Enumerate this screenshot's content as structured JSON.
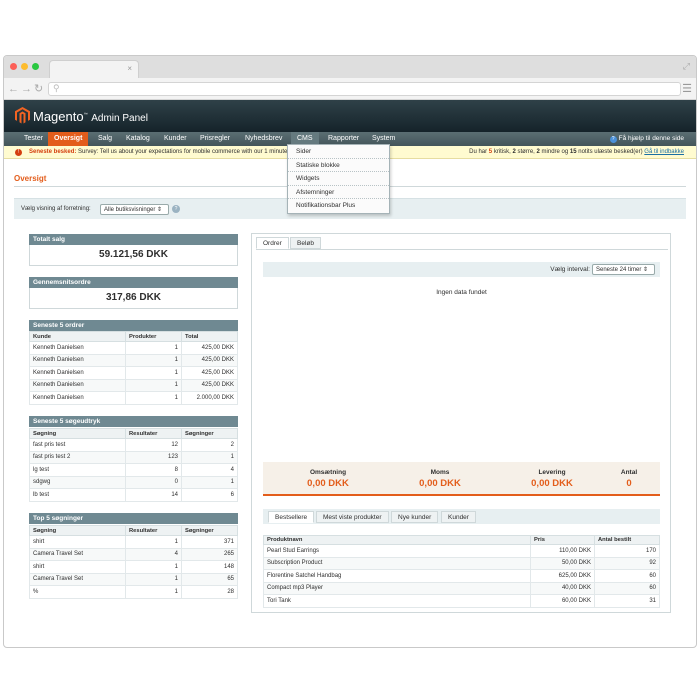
{
  "header": {
    "logo": "Magento",
    "logo_sub": "Admin Panel"
  },
  "nav": {
    "items": [
      "Tester",
      "Oversigt",
      "Salg",
      "Katalog",
      "Kunder",
      "Prisregler",
      "Nyhedsbrev",
      "CMS",
      "Rapporter",
      "System"
    ],
    "help": "Få hjælp til denne side"
  },
  "cms_menu": [
    "Sider",
    "Statiske blokke",
    "Widgets",
    "Afstemninger",
    "Notifikationsbar Plus"
  ],
  "notice": {
    "latest_label": "Seneste besked:",
    "message": "Survey: Tell us about your expectations for mobile commerce with our 1 minute",
    "prefix": "Du har",
    "critical_count": "5",
    "critical_label": "kritisk,",
    "major_count": "2",
    "major_label": "større,",
    "minor_count": "2",
    "minor_label": "mindre og",
    "notice_count": "15",
    "notice_label": "notits ulæste besked(er)",
    "link": "Gå til indbakke"
  },
  "page_title": "Oversigt",
  "store_switcher": {
    "label": "Vælg visning af forretning:",
    "value": "Alle butiksvisninger",
    "help": "?"
  },
  "total_sales": {
    "title": "Totalt salg",
    "value": "59.121,56 DKK"
  },
  "avg_order": {
    "title": "Gennemsnitsordre",
    "value": "317,86 DKK"
  },
  "last_orders": {
    "title": "Seneste 5 ordrer",
    "headers": [
      "Kunde",
      "Produkter",
      "Total"
    ],
    "rows": [
      [
        "Kenneth Danielsen",
        "1",
        "425,00 DKK"
      ],
      [
        "Kenneth Danielsen",
        "1",
        "425,00 DKK"
      ],
      [
        "Kenneth Danielsen",
        "1",
        "425,00 DKK"
      ],
      [
        "Kenneth Danielsen",
        "1",
        "425,00 DKK"
      ],
      [
        "Kenneth Danielsen",
        "1",
        "2.000,00 DKK"
      ]
    ]
  },
  "last_searches": {
    "title": "Seneste 5 søgeudtryk",
    "headers": [
      "Søgning",
      "Resultater",
      "Søgninger"
    ],
    "rows": [
      [
        "fast pris test",
        "12",
        "2"
      ],
      [
        "fast pris test 2",
        "123",
        "1"
      ],
      [
        "lg test",
        "8",
        "4"
      ],
      [
        "sdgwg",
        "0",
        "1"
      ],
      [
        "lb test",
        "14",
        "6"
      ]
    ]
  },
  "top_searches": {
    "title": "Top 5 søgninger",
    "headers": [
      "Søgning",
      "Resultater",
      "Søgninger"
    ],
    "rows": [
      [
        "shirt",
        "1",
        "371"
      ],
      [
        "Camera Travel Set",
        "4",
        "265"
      ],
      [
        "shirt",
        "1",
        "148"
      ],
      [
        "Camera Travel Set",
        "1",
        "65"
      ],
      [
        "%",
        "1",
        "28"
      ]
    ]
  },
  "chart_tabs": [
    "Ordrer",
    "Beløb"
  ],
  "interval": {
    "label": "Vælg interval:",
    "value": "Seneste 24 timer"
  },
  "no_data": "Ingen data fundet",
  "totals": [
    {
      "label": "Omsætning",
      "value": "0,00 DKK"
    },
    {
      "label": "Moms",
      "value": "0,00 DKK"
    },
    {
      "label": "Levering",
      "value": "0,00 DKK"
    },
    {
      "label": "Antal",
      "value": "0"
    }
  ],
  "product_tabs": [
    "Bestsellere",
    "Mest viste produkter",
    "Nye kunder",
    "Kunder"
  ],
  "bestsellers": {
    "headers": [
      "Produktnavn",
      "Pris",
      "Antal bestilt"
    ],
    "rows": [
      [
        "Pearl Stud Earrings",
        "110,00 DKK",
        "170"
      ],
      [
        "Subscription Product",
        "50,00 DKK",
        "92"
      ],
      [
        "Florentine Satchel Handbag",
        "625,00 DKK",
        "60"
      ],
      [
        "Compact mp3 Player",
        "40,00 DKK",
        "60"
      ],
      [
        "Tori Tank",
        "60,00 DKK",
        "31"
      ]
    ]
  },
  "colors": {
    "accent": "#e35d1b",
    "header": "#1d2a30",
    "nav": "#4f6267",
    "box_head": "#6f8992"
  }
}
